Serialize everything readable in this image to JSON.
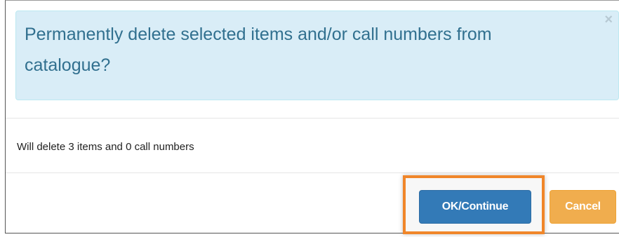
{
  "dialog": {
    "title": "Permanently delete selected items and/or call numbers from catalogue?",
    "close_icon": "close-icon",
    "message": "Will delete 3 items and 0 call numbers",
    "ok_label": "OK/Continue",
    "cancel_label": "Cancel"
  },
  "colors": {
    "alert_bg": "#d9edf7",
    "alert_text": "#31708f",
    "primary": "#337ab7",
    "warning": "#f0ad4e",
    "highlight": "#f0862a"
  }
}
